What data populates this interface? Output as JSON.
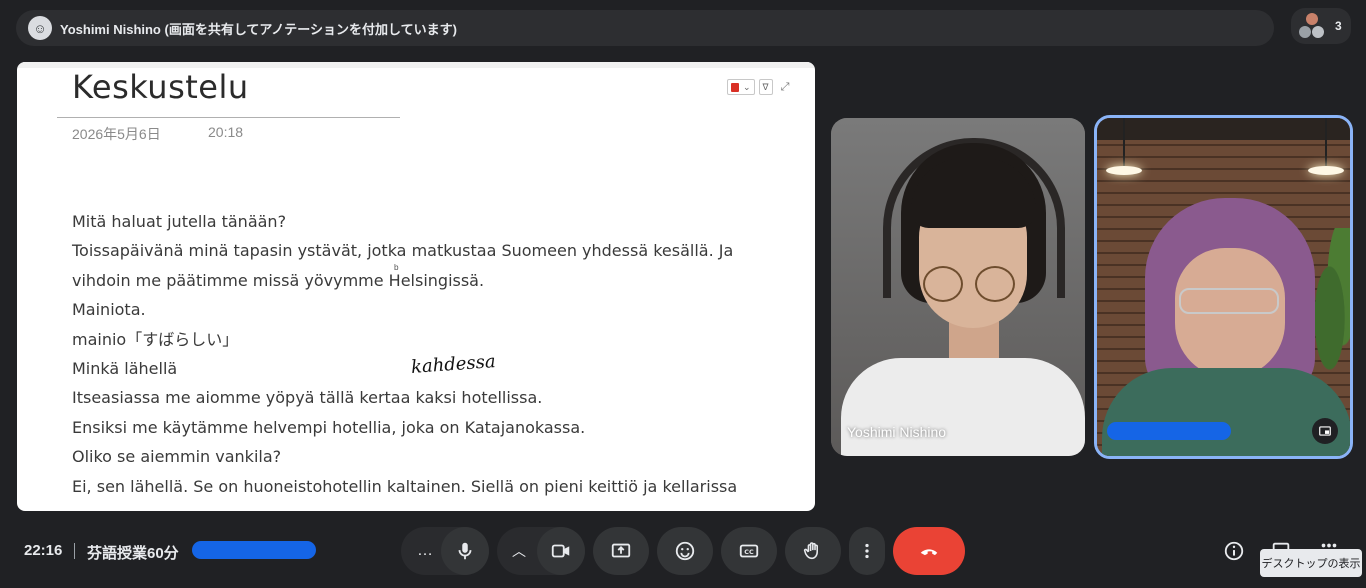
{
  "topbar": {
    "presenter_title": "Yoshimi Nishino (画面を共有してアノテーションを付加しています)",
    "participant_count": "3"
  },
  "document": {
    "title": "Keskustelu",
    "date": "2026年5月6日",
    "time": "20:18",
    "lines": [
      "Mitä haluat jutella tänään?",
      "Toissapäivänä minä tapasin ystävät, jotka matkustaa Suomeen yhdessä kesällä. Ja",
      "vihdoin me päätimme missä yövymme Helsingissä.",
      "Mainiota.",
      "mainio「すばらしい」",
      "Minkä lähellä",
      "Itseasiassa me aiomme yöpyä tällä kertaa kaksi hotellissa.",
      "Ensiksi me käytämme helvempi hotellia, joka on Katajanokassa.",
      "Oliko se aiemmin vankila?",
      "Ei, sen lähellä. Se on huoneistohotellin kaltainen. Siellä on pieni keittiö ja kellarissa"
    ],
    "annotation": "kahdessa"
  },
  "tiles": {
    "tile1_name": "Yoshimi Nishino"
  },
  "bottombar": {
    "clock": "22:16",
    "meeting_title": "芬語授業60分",
    "more_label": "…",
    "tooltip": "デスクトップの表示"
  },
  "colors": {
    "background": "#202124",
    "end_call": "#ea4335",
    "active_speaker": "#8ab4f8",
    "redaction": "#1565e6"
  }
}
